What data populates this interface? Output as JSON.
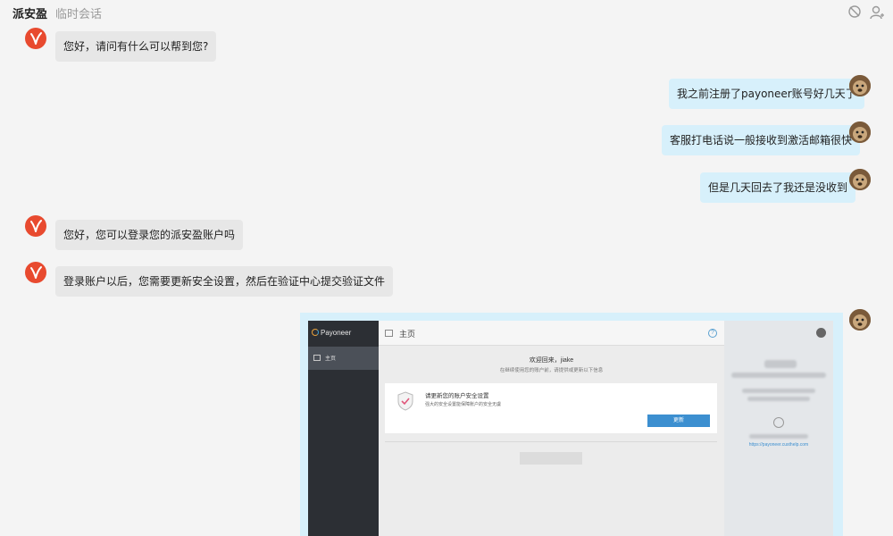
{
  "header": {
    "title": "派安盈",
    "subtitle": "临时会话",
    "icons": [
      "no-notification-icon",
      "add-user-icon"
    ]
  },
  "messages": [
    {
      "from": "agent",
      "text": "您好，请问有什么可以帮到您?"
    },
    {
      "from": "user",
      "text": "我之前注册了payoneer账号好几天了"
    },
    {
      "from": "user",
      "text": "客服打电话说一般接收到激活邮箱很快"
    },
    {
      "from": "user",
      "text": "但是几天回去了我还是没收到"
    },
    {
      "from": "agent",
      "text": "您好，您可以登录您的派安盈账户吗"
    },
    {
      "from": "agent",
      "text": "登录账户以后，您需要更新安全设置，然后在验证中心提交验证文件"
    },
    {
      "from": "user",
      "type": "image"
    }
  ],
  "screenshot": {
    "logo": "Payoneer",
    "nav_label": "主页",
    "page_title": "主页",
    "help_label": "?",
    "welcome": "欢迎回来，jiake",
    "welcome_sub": "在继续使用您的账户前，请提供或更新以下信息",
    "card_title": "请更新您的账户安全设置",
    "card_desc": "强大的安全设置能保障账户的安全无虞",
    "update_button": "更新",
    "profile_link": "https://payoneer.custhelp.com"
  },
  "colors": {
    "agent_avatar": "#e84a2f",
    "agent_bubble": "#e7e7e7",
    "user_bubble": "#d7f0fb",
    "payoneer_button": "#3c8fd0"
  }
}
